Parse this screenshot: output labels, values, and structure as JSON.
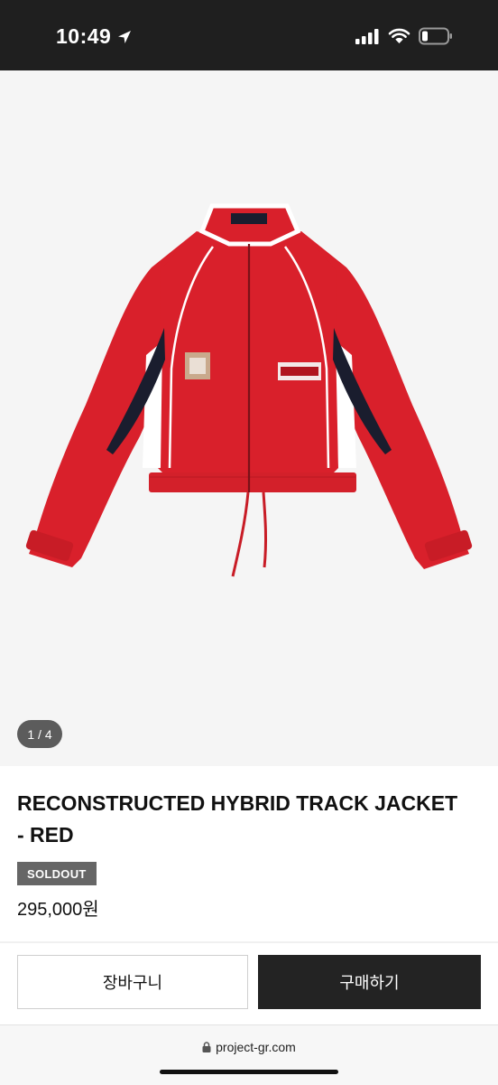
{
  "status_bar": {
    "time": "10:49",
    "icons": [
      "location-arrow-icon",
      "signal-icon",
      "wifi-icon",
      "battery-icon"
    ],
    "battery_level": 0.2
  },
  "product": {
    "image_page": "1 / 4",
    "title": "RECONSTRUCTED HYBRID TRACK JACKET - RED",
    "badge": "SOLDOUT",
    "price": "295,000원"
  },
  "actions": {
    "cart_label": "장바구니",
    "buy_label": "구매하기"
  },
  "browser": {
    "url": "project-gr.com",
    "url_icon": "lock-icon"
  },
  "colors": {
    "jacket_red": "#d9202b",
    "navy_panel": "#1a1d2e",
    "dark_button": "#232323",
    "badge_gray": "#666666"
  }
}
